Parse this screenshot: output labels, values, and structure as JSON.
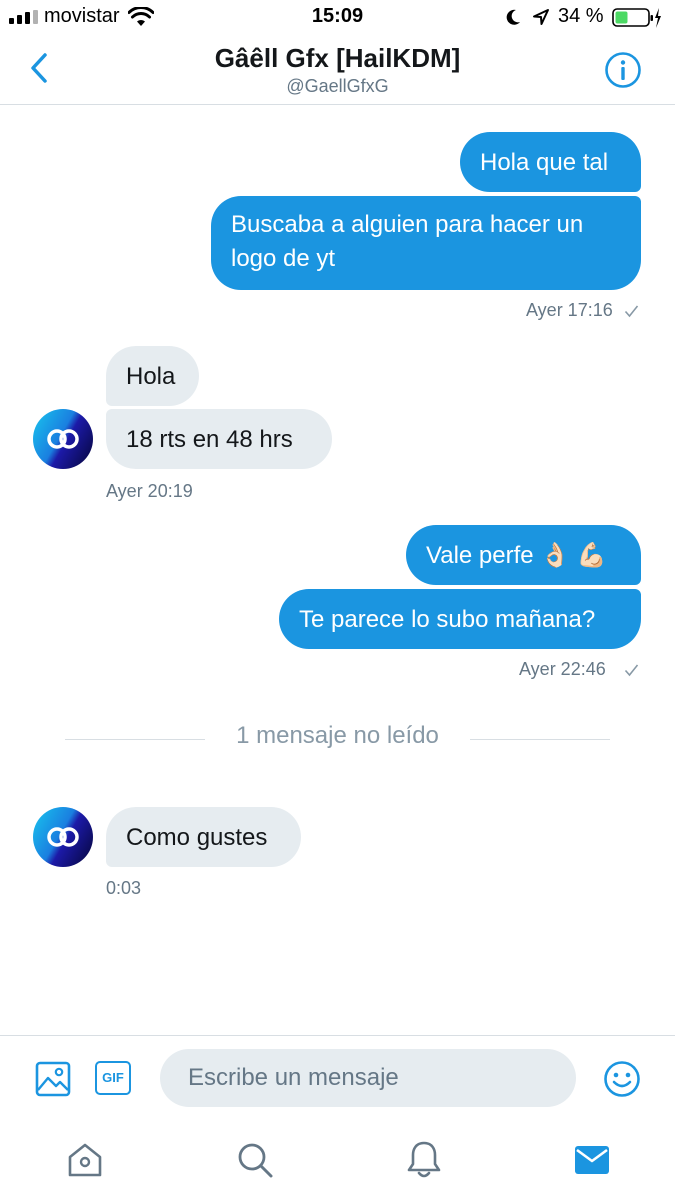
{
  "status_bar": {
    "carrier": "movistar",
    "time": "15:09",
    "battery": "34 %"
  },
  "header": {
    "title": "Gâêll Gfx [HailKDM]",
    "handle": "@GaellGfxG"
  },
  "messages": [
    {
      "text": "Hola que tal",
      "direction": "outgoing"
    },
    {
      "text": "Buscaba a alguien para hacer un logo de yt",
      "direction": "outgoing"
    },
    {
      "text": "Hola",
      "direction": "incoming"
    },
    {
      "text": "18 rts en 48 hrs",
      "direction": "incoming"
    },
    {
      "text": "Vale perfe 👌🏻 💪🏻",
      "direction": "outgoing"
    },
    {
      "text": "Te parece lo subo mañana?",
      "direction": "outgoing"
    },
    {
      "text": "Como gustes",
      "direction": "incoming"
    }
  ],
  "timestamps": {
    "t1": "Ayer 17:16",
    "t2": "Ayer 20:19",
    "t3": "Ayer 22:46",
    "t4": "0:03"
  },
  "unread_divider": "1 mensaje no leído",
  "composer": {
    "placeholder": "Escribe un mensaje",
    "gif_label": "GIF"
  },
  "colors": {
    "accent": "#1b95e0",
    "incoming_bubble": "#e6ecf0",
    "battery_fill": "#4cd964"
  },
  "icons": [
    "back-arrow-icon",
    "info-icon",
    "image-icon",
    "gif-icon",
    "emoji-icon",
    "home-icon",
    "search-icon",
    "notifications-bell-icon",
    "messages-envelope-icon"
  ]
}
